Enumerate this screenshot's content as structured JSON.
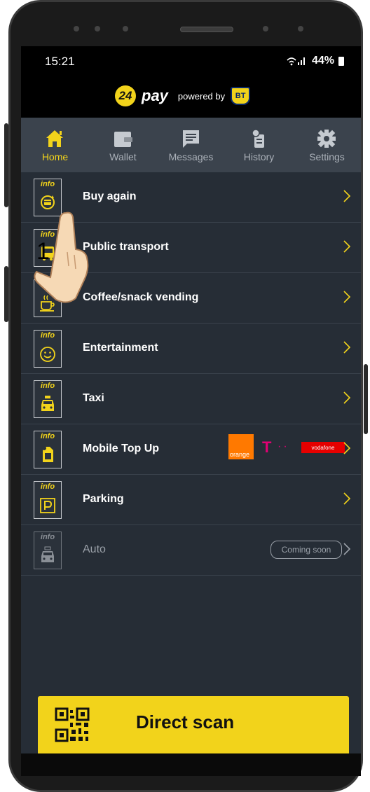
{
  "status_bar": {
    "time": "15:21",
    "battery": "44%"
  },
  "brand": {
    "logo_24": "24",
    "logo_pay": "pay",
    "powered_by": "powered by",
    "partner": "BT"
  },
  "tabs": [
    {
      "label": "Home",
      "icon": "home-icon",
      "active": true
    },
    {
      "label": "Wallet",
      "icon": "wallet-icon",
      "active": false
    },
    {
      "label": "Messages",
      "icon": "message-icon",
      "active": false
    },
    {
      "label": "History",
      "icon": "history-icon",
      "active": false
    },
    {
      "label": "Settings",
      "icon": "gear-icon",
      "active": false
    }
  ],
  "menu": [
    {
      "label": "Buy again",
      "info": "info",
      "icon": "buy-again-icon"
    },
    {
      "label": "Public transport",
      "info": "info",
      "icon": "bus-icon"
    },
    {
      "label": "Coffee/snack vending",
      "info": "info",
      "icon": "coffee-cup-icon"
    },
    {
      "label": "Entertainment",
      "info": "info",
      "icon": "smiley-icon"
    },
    {
      "label": "Taxi",
      "info": "info",
      "icon": "taxi-icon"
    },
    {
      "label": "Mobile Top Up",
      "info": "info",
      "icon": "sim-card-icon",
      "operators": {
        "orange": "orange",
        "vodafone": "vodafone"
      }
    },
    {
      "label": "Parking",
      "info": "info",
      "icon": "parking-icon"
    },
    {
      "label": "Auto",
      "info": "info",
      "icon": "car-icon",
      "badge": "Coming soon"
    }
  ],
  "direct_scan": {
    "label": "Direct scan",
    "icon": "qr-code-icon"
  },
  "tutorial": {
    "step": "1"
  },
  "colors": {
    "accent": "#f2d31b",
    "background": "#262d36",
    "tabbar": "#3b434d"
  }
}
